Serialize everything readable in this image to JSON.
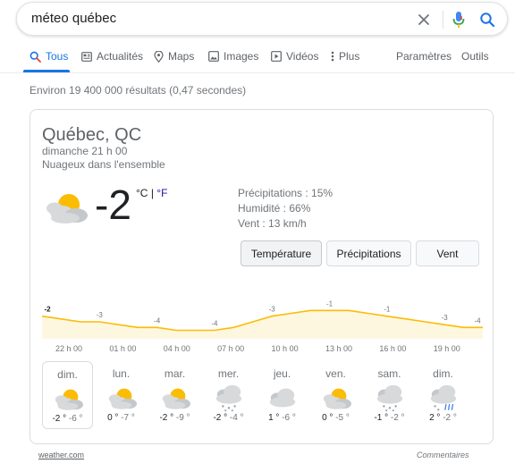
{
  "search": {
    "query": "méteo québec"
  },
  "tabs": [
    {
      "label": "Tous",
      "icon": "search-icon",
      "active": true
    },
    {
      "label": "Actualités",
      "icon": "news-icon"
    },
    {
      "label": "Maps",
      "icon": "map-pin-icon"
    },
    {
      "label": "Images",
      "icon": "image-icon"
    },
    {
      "label": "Vidéos",
      "icon": "video-icon"
    },
    {
      "label": "Plus",
      "icon": "more-vertical-icon"
    }
  ],
  "settings_label": "Paramètres",
  "tools_label": "Outils",
  "results_stats": "Environ 19 400 000 résultats (0,47 secondes)",
  "weather": {
    "location": "Québec, QC",
    "datetime": "dimanche 21 h 00",
    "condition": "Nuageux dans l'ensemble",
    "temperature": "-2",
    "unit_c": "°C",
    "unit_sep": "|",
    "unit_f": "°F",
    "precipitation": "Précipitations : 15%",
    "humidity": "Humidité : 66%",
    "wind": "Vent : 13 km/h",
    "buttons": [
      "Température",
      "Précipitations",
      "Vent"
    ],
    "active_button": "Température",
    "accent_color": "#fbbc04",
    "fill_color": "#fef7e0"
  },
  "chart_data": {
    "type": "area",
    "x": [
      "22 h 00",
      "23 h 00",
      "00 h 00",
      "01 h 00",
      "02 h 00",
      "03 h 00",
      "04 h 00",
      "05 h 00",
      "06 h 00",
      "07 h 00",
      "08 h 00",
      "09 h 00",
      "10 h 00",
      "11 h 00",
      "12 h 00",
      "13 h 00",
      "14 h 00",
      "15 h 00",
      "16 h 00",
      "17 h 00",
      "18 h 00",
      "19 h 00",
      "20 h 00",
      "21 h 00"
    ],
    "values": [
      -2,
      -2.5,
      -3,
      -3,
      -3.5,
      -4,
      -4,
      -4.5,
      -4.5,
      -4.5,
      -4,
      -3,
      -2,
      -1.5,
      -1,
      -1,
      -1,
      -1.5,
      -2,
      -2.5,
      -3,
      -3.5,
      -4,
      -4
    ],
    "data_labels": [
      "-2",
      "-3",
      "-4",
      "-4",
      "-3",
      "-1",
      "-1",
      "-3",
      "-4"
    ],
    "label_indices": [
      0,
      3,
      6,
      9,
      12,
      15,
      18,
      21,
      23
    ],
    "hour_ticks": [
      "22 h 00",
      "01 h 00",
      "04 h 00",
      "07 h 00",
      "10 h 00",
      "13 h 00",
      "16 h 00",
      "19 h 00"
    ],
    "unit": "°C",
    "line_color": "#fbbc04",
    "fill_color": "#fef7e0"
  },
  "forecast": [
    {
      "day": "dim.",
      "icon": "partly-cloudy-icon",
      "hi": "-2 °",
      "lo": "-6 °",
      "selected": true
    },
    {
      "day": "lun.",
      "icon": "partly-cloudy-icon",
      "hi": "0 °",
      "lo": "-7 °"
    },
    {
      "day": "mar.",
      "icon": "partly-cloudy-icon",
      "hi": "-2 °",
      "lo": "-9 °"
    },
    {
      "day": "mer.",
      "icon": "snow-icon",
      "hi": "-2 °",
      "lo": "-4 °"
    },
    {
      "day": "jeu.",
      "icon": "cloudy-icon",
      "hi": "1 °",
      "lo": "-6 °"
    },
    {
      "day": "ven.",
      "icon": "partly-cloudy-icon",
      "hi": "0 °",
      "lo": "-5 °"
    },
    {
      "day": "sam.",
      "icon": "snow-icon",
      "hi": "-1 °",
      "lo": "-2 °"
    },
    {
      "day": "dim.",
      "icon": "rain-snow-icon",
      "hi": "2 °",
      "lo": "-2 °"
    }
  ],
  "footer": {
    "source": "weather.com",
    "feedback": "Commentaires"
  }
}
